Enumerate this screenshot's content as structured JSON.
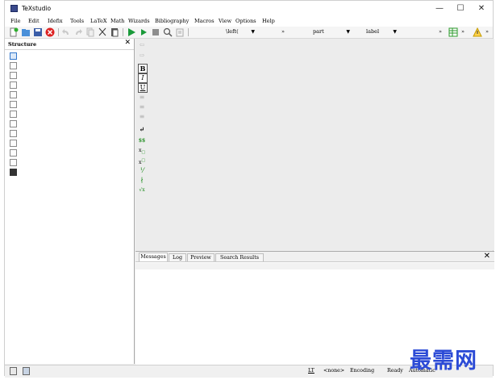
{
  "window": {
    "title": "TeXstudio",
    "minimize_glyph": "—",
    "maximize_glyph": "☐",
    "close_glyph": "✕"
  },
  "menu": [
    "File",
    "Edit",
    "Idefix",
    "Tools",
    "LaTeX",
    "Math",
    "Wizards",
    "Bibliography",
    "Macros",
    "View",
    "Options",
    "Help"
  ],
  "toolbar": {
    "left_delim_combo": "\\left(",
    "part_combo": "part",
    "label_combo": "label",
    "overflow": "»"
  },
  "structure": {
    "title": "Structure",
    "close": "✕"
  },
  "vertical_toolbar": {
    "bold": "B",
    "italic": "I",
    "underline": "U",
    "newline": "↵",
    "math": "$$",
    "frac": "⅟",
    "sqrt": "√x"
  },
  "messages": {
    "tabs": [
      "Messages",
      "Log",
      "Preview",
      "Search Results"
    ],
    "close": "✕"
  },
  "status": {
    "lt": "LT",
    "dictionary": "<none>",
    "encoding": "Encoding",
    "state": "Ready",
    "mode": "Automatic"
  },
  "watermark": "最需网"
}
